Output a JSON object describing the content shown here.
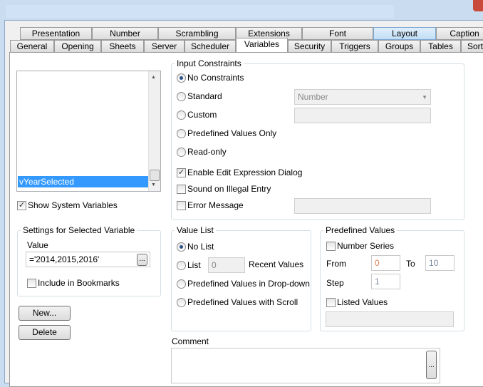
{
  "tabs_row1": [
    "Presentation",
    "Number",
    "Scrambling",
    "Extensions",
    "Font",
    "Layout",
    "Caption"
  ],
  "tabs_row2": [
    "General",
    "Opening",
    "Sheets",
    "Server",
    "Scheduler",
    "Variables",
    "Security",
    "Triggers",
    "Groups",
    "Tables",
    "Sort"
  ],
  "variables": {
    "selected": "vYearSelected",
    "show_system": "Show System Variables"
  },
  "settings": {
    "title": "Settings for Selected Variable",
    "value_label": "Value",
    "value": "='2014,2015,2016'",
    "browse": "...",
    "include_bookmarks": "Include in Bookmarks"
  },
  "buttons": {
    "new": "New...",
    "delete": "Delete"
  },
  "input_constraints": {
    "title": "Input Constraints",
    "no_constraints": "No Constraints",
    "standard": "Standard",
    "standard_value": "Number",
    "custom": "Custom",
    "predefined_only": "Predefined Values Only",
    "read_only": "Read-only",
    "enable_edit": "Enable Edit Expression Dialog",
    "sound": "Sound on Illegal Entry",
    "error_message": "Error Message"
  },
  "value_list": {
    "title": "Value List",
    "no_list": "No List",
    "list": "List",
    "list_count": "0",
    "recent": "Recent Values",
    "dropdown": "Predefined Values in Drop-down",
    "scroll": "Predefined Values with Scroll"
  },
  "predefined": {
    "title": "Predefined Values",
    "number_series": "Number Series",
    "from_label": "From",
    "from": "0",
    "to_label": "To",
    "to": "10",
    "step_label": "Step",
    "step": "1",
    "listed": "Listed Values"
  },
  "comment": {
    "label": "Comment",
    "browse": "..."
  }
}
